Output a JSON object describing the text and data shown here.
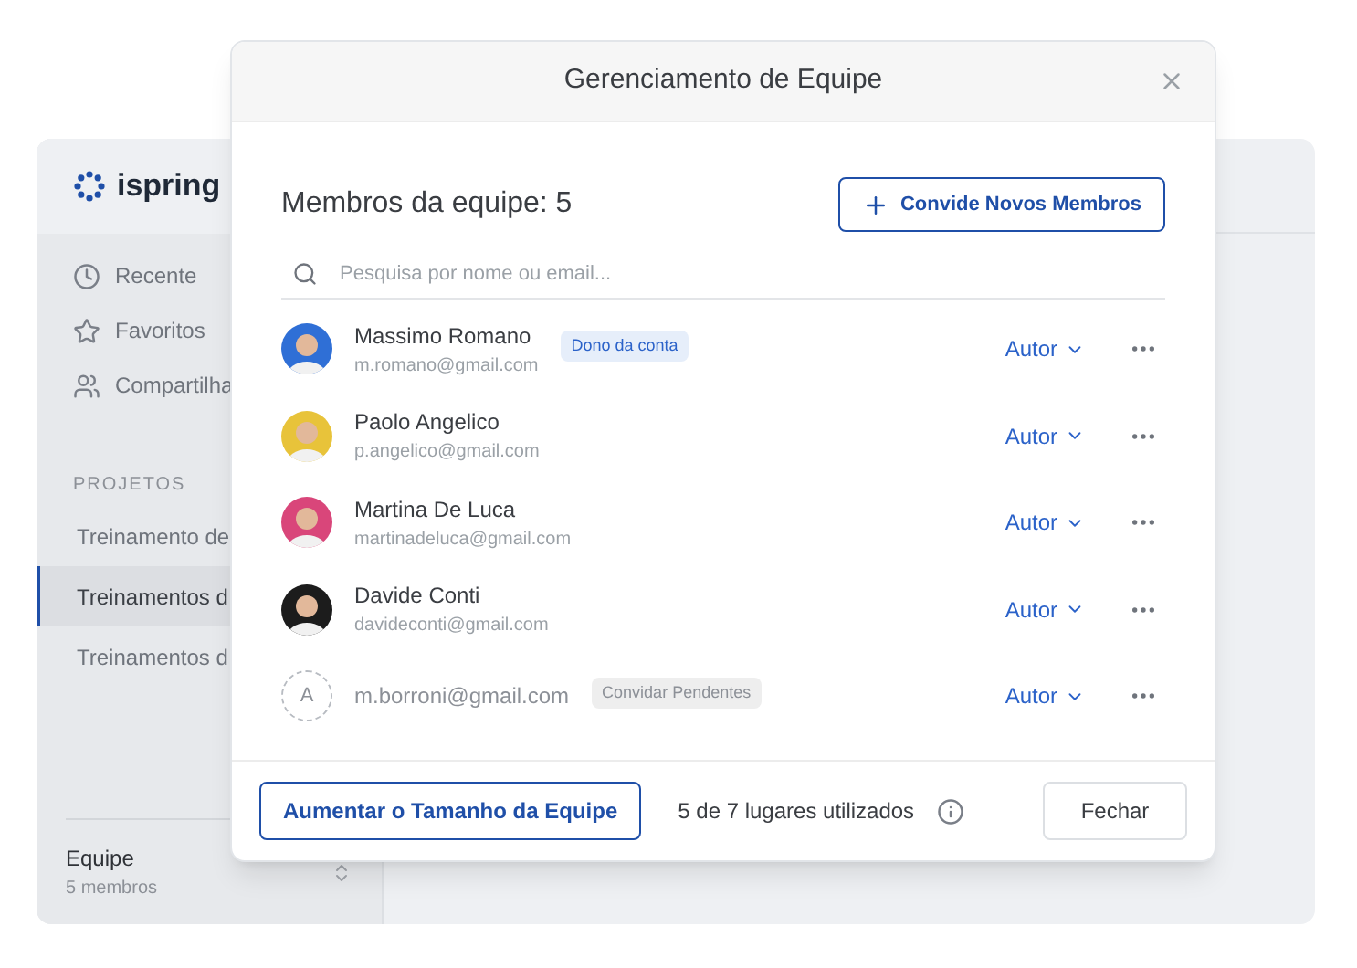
{
  "app": {
    "logo": "ispring",
    "nav": [
      {
        "label": "Recente"
      },
      {
        "label": "Favoritos"
      },
      {
        "label": "Compartilha"
      }
    ],
    "projects_heading": "PROJETOS",
    "projects": [
      {
        "label": "Treinamento de",
        "selected": false
      },
      {
        "label": "Treinamentos d",
        "selected": true
      },
      {
        "label": "Treinamentos d",
        "selected": false
      }
    ],
    "team": {
      "name": "Equipe",
      "count": "5 membros"
    }
  },
  "dialog": {
    "title": "Gerenciamento de Equipe",
    "members_heading": "Membros da equipe: 5",
    "invite_button": "Convide Novos Membros",
    "search": {
      "placeholder": "Pesquisa por nome ou email..."
    },
    "members": [
      {
        "kind": "member",
        "name": "Massimo Romano",
        "email": "m.romano@gmail.com",
        "badge": "Dono da conta",
        "role": "Autor",
        "color": "#2f6fd6"
      },
      {
        "kind": "member",
        "name": "Paolo Angelico",
        "email": "p.angelico@gmail.com",
        "role": "Autor",
        "color": "#e8c33a"
      },
      {
        "kind": "member",
        "name": "Martina De Luca",
        "email": "martinadeluca@gmail.com",
        "role": "Autor",
        "color": "#d9467a"
      },
      {
        "kind": "member",
        "name": "Davide Conti",
        "email": "davideconti@gmail.com",
        "role": "Autor",
        "color": "#1c1c1c"
      },
      {
        "kind": "pending",
        "initial": "A",
        "email": "m.borroni@gmail.com",
        "badge": "Convidar Pendentes",
        "role": "Autor"
      }
    ],
    "increase_button": "Aumentar o Tamanho da Equipe",
    "seats": "5 de 7 lugares utilizados",
    "close_button": "Fechar"
  }
}
